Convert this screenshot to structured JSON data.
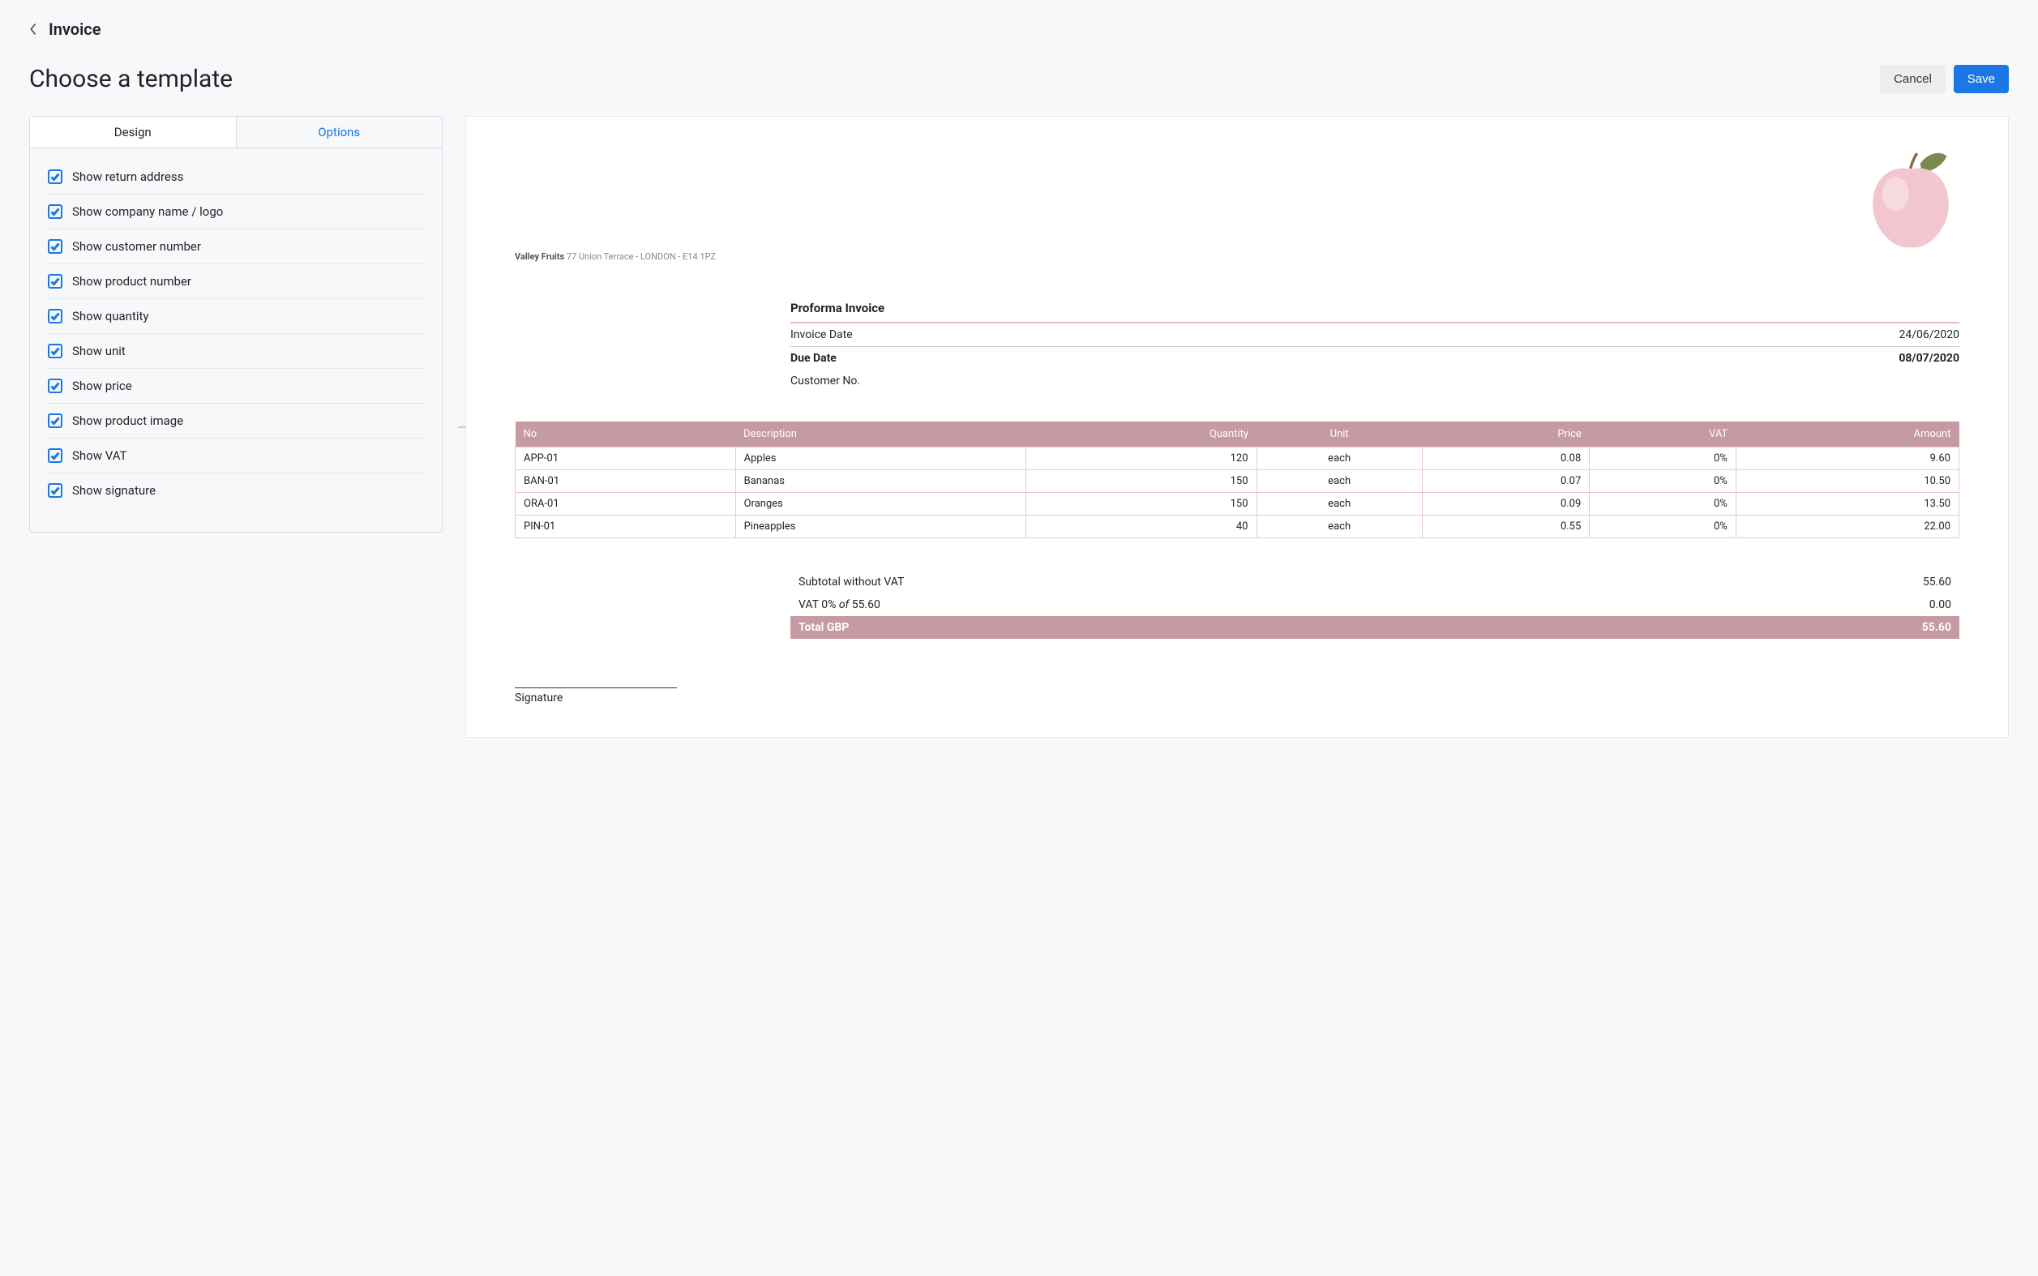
{
  "top": {
    "back_label": "Invoice"
  },
  "header": {
    "title": "Choose a template",
    "cancel": "Cancel",
    "save": "Save"
  },
  "tabs": {
    "design": "Design",
    "options": "Options"
  },
  "options": [
    "Show return address",
    "Show company name / logo",
    "Show customer number",
    "Show product number",
    "Show quantity",
    "Show unit",
    "Show price",
    "Show product image",
    "Show VAT",
    "Show signature"
  ],
  "invoice": {
    "company_name": "Valley Fruits",
    "return_address": "77 Union Terrace - LONDON - E14 1PZ",
    "doc_title": "Proforma Invoice",
    "labels": {
      "invoice_date": "Invoice Date",
      "due_date": "Due Date",
      "customer_no": "Customer No."
    },
    "invoice_date": "24/06/2020",
    "due_date": "08/07/2020",
    "columns": {
      "no": "No",
      "description": "Description",
      "quantity": "Quantity",
      "unit": "Unit",
      "price": "Price",
      "vat": "VAT",
      "amount": "Amount"
    },
    "items": [
      {
        "no": "APP-01",
        "desc": "Apples",
        "qty": "120",
        "unit": "each",
        "price": "0.08",
        "vat": "0%",
        "amount": "9.60"
      },
      {
        "no": "BAN-01",
        "desc": "Bananas",
        "qty": "150",
        "unit": "each",
        "price": "0.07",
        "vat": "0%",
        "amount": "10.50"
      },
      {
        "no": "ORA-01",
        "desc": "Oranges",
        "qty": "150",
        "unit": "each",
        "price": "0.09",
        "vat": "0%",
        "amount": "13.50"
      },
      {
        "no": "PIN-01",
        "desc": "Pineapples",
        "qty": "40",
        "unit": "each",
        "price": "0.55",
        "vat": "0%",
        "amount": "22.00"
      }
    ],
    "totals": {
      "subtotal_label": "Subtotal without VAT",
      "subtotal_value": "55.60",
      "vat_line_prefix": "VAT 0% ",
      "vat_line_of": "of",
      "vat_line_base": " 55.60",
      "vat_value": "0.00",
      "total_label": "Total GBP",
      "total_value": "55.60"
    },
    "signature_label": "Signature"
  }
}
